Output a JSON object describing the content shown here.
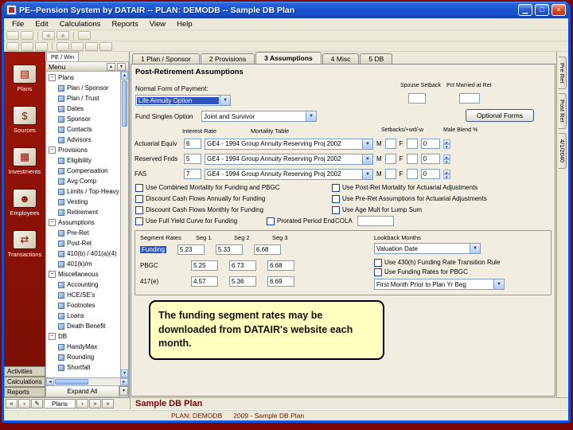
{
  "window": {
    "title": "PE--Pension System by DATAIR -- PLAN: DEMODB -- Sample DB Plan",
    "controls": {
      "minimize": "▁",
      "maximize": "□",
      "close": "×"
    }
  },
  "icons": {
    "dropdown": "▼",
    "up": "▲",
    "down": "▼",
    "left": "◄",
    "right": "►",
    "collapse": "−",
    "back": "«",
    "forward": "»"
  },
  "menu_bar": {
    "items": [
      "File",
      "Edit",
      "Calculations",
      "Reports",
      "View",
      "Help"
    ]
  },
  "sidebar": {
    "items": [
      {
        "label": "Plans",
        "icon": "plans-icon",
        "glyph": "▤"
      },
      {
        "label": "Sources",
        "icon": "sources-icon",
        "glyph": "$"
      },
      {
        "label": "Investments",
        "icon": "investments-icon",
        "glyph": "▦"
      },
      {
        "label": "Employees",
        "icon": "employees-icon",
        "glyph": "☻"
      },
      {
        "label": "Transactions",
        "icon": "transactions-icon",
        "glyph": "⇄"
      }
    ],
    "bottom_buttons": [
      "Activities",
      "Calculations",
      "Reports"
    ]
  },
  "tree_panel": {
    "tab_label": "PE / Win",
    "header": "Menu",
    "expand_all": "Expand All",
    "items": [
      {
        "label": "Plans",
        "level": 0,
        "node": true
      },
      {
        "label": "Plan / Sponsor",
        "level": 1
      },
      {
        "label": "Plan / Trust",
        "level": 1
      },
      {
        "label": "Dates",
        "level": 1
      },
      {
        "label": "Sponsor",
        "level": 1
      },
      {
        "label": "Contacts",
        "level": 1
      },
      {
        "label": "Advisors",
        "level": 1
      },
      {
        "label": "Provisions",
        "level": 0,
        "node": true
      },
      {
        "label": "Eligibility",
        "level": 1
      },
      {
        "label": "Compensation",
        "level": 1
      },
      {
        "label": "Avg Comp",
        "level": 1
      },
      {
        "label": "Limits / Top-Heavy",
        "level": 1
      },
      {
        "label": "Vesting",
        "level": 1
      },
      {
        "label": "Retirement",
        "level": 1
      },
      {
        "label": "Assumptions",
        "level": 0,
        "node": true
      },
      {
        "label": "Pre-Ret",
        "level": 1
      },
      {
        "label": "Post-Ret",
        "level": 1
      },
      {
        "label": "410(b) / 401(a)(4)",
        "level": 1
      },
      {
        "label": "401(k)/m",
        "level": 1
      },
      {
        "label": "Miscellaneous",
        "level": 0,
        "node": true
      },
      {
        "label": "Accounting",
        "level": 1
      },
      {
        "label": "HCE/SE's",
        "level": 1
      },
      {
        "label": "Footnotes",
        "level": 1
      },
      {
        "label": "Loans",
        "level": 1
      },
      {
        "label": "Death Benefit",
        "level": 1
      },
      {
        "label": "DB",
        "level": 0,
        "node": true
      },
      {
        "label": "HandyMax",
        "level": 1
      },
      {
        "label": "Rounding",
        "level": 1
      },
      {
        "label": "Shortfall",
        "level": 1
      }
    ]
  },
  "tabs": [
    "1 Plan / Sponsor",
    "2 Provisions",
    "3 Assumptions",
    "4 Misc",
    "5 DB"
  ],
  "active_tab": "3 Assumptions",
  "right_tabs": [
    "Pre Ret",
    "Post Ret",
    "4/1/2040"
  ],
  "form": {
    "section_title": "Post-Retirement Assumptions",
    "normal_form": {
      "label": "Normal Form of Payment:",
      "value": "Life Annuity Option"
    },
    "spouse_setback": {
      "label": "Spouse Setback",
      "value": ""
    },
    "pct_married": {
      "label": "Pct Married at Ret",
      "value": ""
    },
    "fund_singles": {
      "label": "Fund Singles Option",
      "value": "Joint and Survivor"
    },
    "optional_forms_button": "Optional Forms",
    "mortality": {
      "headers": {
        "interest": "Interest Rate",
        "table": "Mortality Table",
        "setback": "Setbacks/+wd/-w",
        "blend": "Male Blend %"
      },
      "rows": [
        {
          "label": "Actuarial Equiv",
          "rate": "6",
          "table": "GE4 - 1994 Group Annuity Reserving Proj 2002",
          "m": "M",
          "f": "F",
          "blend": "0"
        },
        {
          "label": "Reserved Fnds",
          "rate": "5",
          "table": "GE4 - 1994 Group Annuity Reserving Proj 2002",
          "m": "M",
          "f": "F",
          "blend": "0"
        },
        {
          "label": "FAS",
          "rate": "7",
          "table": "GE4 - 1994 Group Annuity Reserving Proj 2002",
          "m": "M",
          "f": "F",
          "blend": "0"
        }
      ]
    },
    "checkboxes_left": [
      "Use Combined Mortality for Funding and PBGC",
      "Discount Cash Flows Annually for Funding",
      "Discount Cash Flows Monthly for Funding",
      "Use Full Yield Curve for Funding"
    ],
    "prorated_checkbox": "Prorated Period End",
    "checkboxes_right": [
      "Use Post-Ret Mortality for Actuarial Adjustments",
      "Use Pre-Ret Assumptions for Actuarial Adjustments",
      "Use Age Mult for Lump Sum"
    ],
    "cola": {
      "label": "COLA",
      "value": ""
    },
    "segment_rates": {
      "title": "Segment Rates",
      "col_headers": [
        "Seg 1",
        "Seg 2",
        "Seg 3"
      ],
      "rows": [
        {
          "label": "Funding",
          "selected": true,
          "values": [
            "5.23",
            "5.33",
            "6.68"
          ]
        },
        {
          "label": "PBGC",
          "values": [
            "5.25",
            "6.73",
            "6.68"
          ]
        },
        {
          "label": "417(e)",
          "values": [
            "4.57",
            "5.36",
            "6.69"
          ]
        }
      ],
      "lookback_label": "Lookback Months",
      "valuation_dropdown": "Valuation Date",
      "transition_checkbox": "Use 430(h) Funding Rate Transition Rule",
      "pbgc_checkbox": "Use Funding Rates for PBGC",
      "first_month_dropdown": "First Month Prior to Plan Yr Beg"
    }
  },
  "callout": {
    "text": "The funding segment rates may be downloaded from DATAIR's website each month."
  },
  "bottom": {
    "nav_left": [
      {
        "glyph": "«",
        "name": "first"
      },
      {
        "glyph": "‹",
        "name": "previous"
      },
      {
        "glyph": "✎",
        "name": "edit"
      }
    ],
    "nav_tab": "Plans",
    "nav_right": [
      {
        "glyph": "›",
        "name": "next"
      },
      {
        "glyph": "»",
        "name": "last"
      },
      {
        "glyph": "»",
        "name": "last-page"
      }
    ],
    "plan_name": "Sample DB Plan",
    "plan_code": "PLAN: DEMODB",
    "plan_desc": "2009 - Sample DB Plan"
  }
}
